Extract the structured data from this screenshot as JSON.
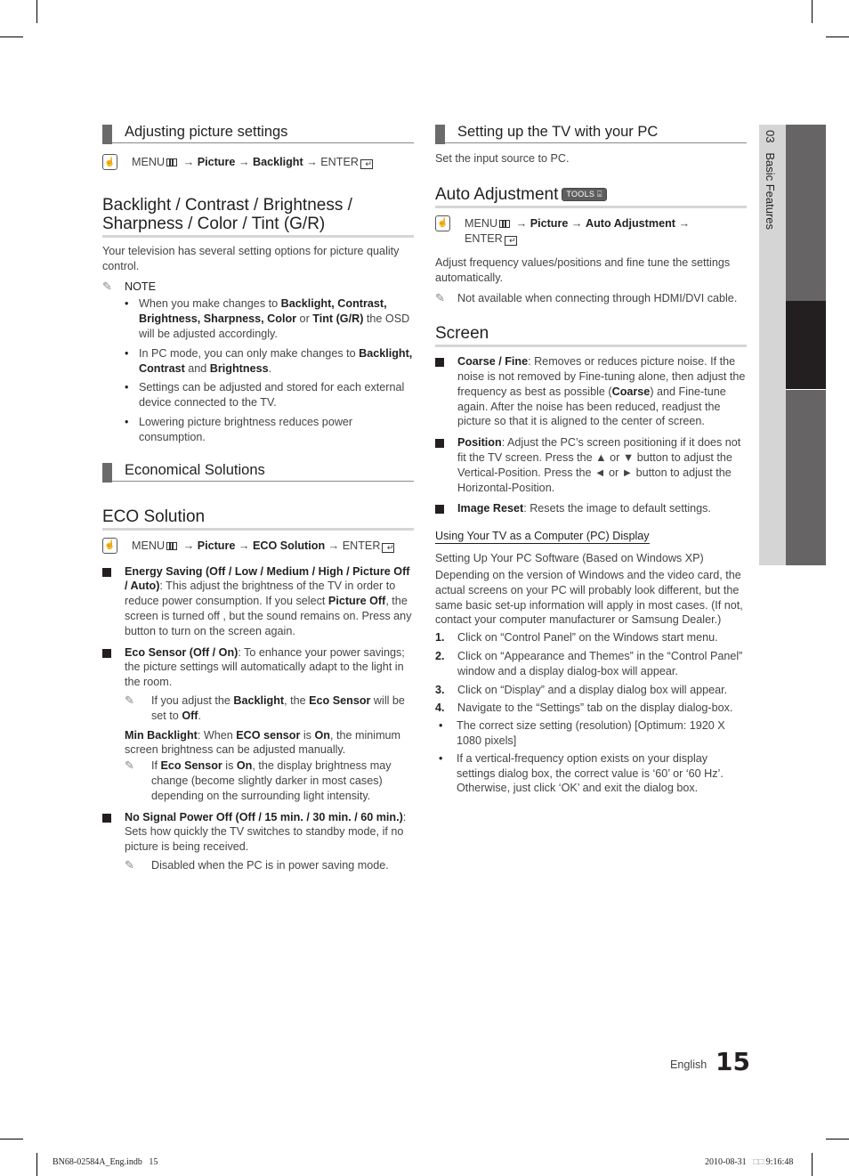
{
  "left": {
    "section1": {
      "title": "Adjusting picture settings",
      "menu": {
        "menu": "MENU",
        "arrow": "→",
        "path1": "Picture",
        "path2": "Backlight",
        "enter": "ENTER"
      }
    },
    "heading1": {
      "line1": "Backlight / Contrast / Brightness /",
      "line2": "Sharpness / Color / Tint (G/R)"
    },
    "intro": "Your television has several setting options for picture quality control.",
    "note_label": "NOTE",
    "notes": [
      {
        "pre": "When you make changes to ",
        "b1": "Backlight, Contrast, Brightness, Sharpness, Color",
        "mid": " or ",
        "b2": "Tint (G/R)",
        "post": " the OSD will be adjusted accordingly."
      },
      {
        "pre": "In PC mode, you can only make changes to ",
        "b1": "Backlight, Contrast",
        "mid": " and ",
        "b2": "Brightness",
        "post": "."
      },
      {
        "text": "Settings can be adjusted and stored for each external device connected to the TV."
      },
      {
        "text": "Lowering picture brightness reduces power consumption."
      }
    ],
    "section2": {
      "title": "Economical Solutions"
    },
    "heading2": "ECO Solution",
    "menu2": {
      "menu": "MENU",
      "path1": "Picture",
      "path2": "ECO Solution",
      "enter": "ENTER"
    },
    "items": {
      "energy": {
        "b1": "Energy Saving (Off / Low / Medium / High / Picture Off / Auto)",
        "t1": ": This adjust the brightness of the TV in order to reduce power consumption. If you select ",
        "b2": "Picture Off",
        "t2": ", the screen is turned off , but the sound remains on. Press any button to turn on the screen again."
      },
      "eco_sensor": {
        "b1": "Eco Sensor (Off / On)",
        "t1": ": To enhance your power savings; the picture settings will automatically adapt to the light in the room."
      },
      "eco_note1": {
        "t1": "If you adjust the ",
        "b1": "Backlight",
        "t2": ", the ",
        "b2": "Eco Sensor",
        "t3": " will be set to ",
        "b3": "Off",
        "t4": "."
      },
      "min_backlight": {
        "b1": "Min Backlight",
        "t1": ": When ",
        "b2": "ECO sensor",
        "t2": " is ",
        "b3": "On",
        "t3": ", the minimum screen brightness can be adjusted manually."
      },
      "eco_note2": {
        "t1": "If ",
        "b1": "Eco Sensor",
        "t2": " is ",
        "b2": "On",
        "t3": ", the display brightness may change (become slightly darker in most cases) depending on the surrounding light intensity."
      },
      "no_signal": {
        "b1": "No Signal Power Off (Off / 15 min. / 30 min. / 60 min.)",
        "t1": ": Sets how quickly the TV switches to standby mode, if no picture is being received."
      },
      "no_signal_note": "Disabled when the PC is in power saving mode."
    }
  },
  "right": {
    "section1": {
      "title": "Setting up the TV with your PC"
    },
    "input_source": "Set the input source to PC.",
    "auto_adj": {
      "title": "Auto Adjustment",
      "tools_badge": "TOOLS"
    },
    "menu": {
      "menu": "MENU",
      "path1": "Picture",
      "path2": "Auto Adjustment",
      "enter": "ENTER"
    },
    "auto_desc": "Adjust frequency values/positions and fine tune the settings automatically.",
    "auto_note": "Not available when connecting through HDMI/DVI cable.",
    "screen": {
      "title": "Screen",
      "coarse": {
        "b1": "Coarse / Fine",
        "t1": ": Removes or reduces picture noise. If the noise is not removed by Fine-tuning alone, then adjust the frequency as best as possible (",
        "b2": "Coarse",
        "t2": ") and Fine-tune again. After the noise has been reduced, readjust the picture so that it is aligned to the center of screen."
      },
      "position": {
        "b1": "Position",
        "t1": ": Adjust the PC’s screen positioning if it does not fit the TV screen. Press the ▲ or ▼ button to adjust the Vertical-Position. Press the ◄ or ► button to adjust the Horizontal-Position."
      },
      "reset": {
        "b1": "Image Reset",
        "t1": ": Resets the image to default settings."
      }
    },
    "pc_display": {
      "link": "Using Your TV as a Computer (PC) Display",
      "subtitle": "Setting Up Your PC Software (Based on Windows XP)",
      "desc": "Depending on the version of Windows and the video card, the actual screens on your PC will probably look different, but the same basic set-up information will apply in most cases. (If not, contact your computer manufacturer or Samsung Dealer.)",
      "steps": [
        {
          "n": "1.",
          "text": "Click on “Control Panel” on the Windows start menu."
        },
        {
          "n": "2.",
          "text": "Click on “Appearance and Themes” in the “Control Panel” window and a display dialog-box will appear."
        },
        {
          "n": "3.",
          "text": "Click on “Display” and a display dialog box will appear."
        },
        {
          "n": "4.",
          "text": "Navigate to the “Settings” tab on the display dialog-box."
        }
      ],
      "bullets": [
        "The correct size setting (resolution) [Optimum: 1920 X 1080 pixels]",
        "If a vertical-frequency option exists on your display settings dialog box, the correct value is ‘60’ or ‘60 Hz’. Otherwise, just click ‘OK’ and exit the dialog box."
      ]
    }
  },
  "side_tab": {
    "chapter": "03",
    "title": "Basic Features"
  },
  "footer": {
    "language": "English",
    "page": "15"
  },
  "slug": {
    "file": "BN68-02584A_Eng.indb   15",
    "date": "2010-08-31",
    "unknown_glyphs": "□□",
    "time": "9:16:48"
  }
}
